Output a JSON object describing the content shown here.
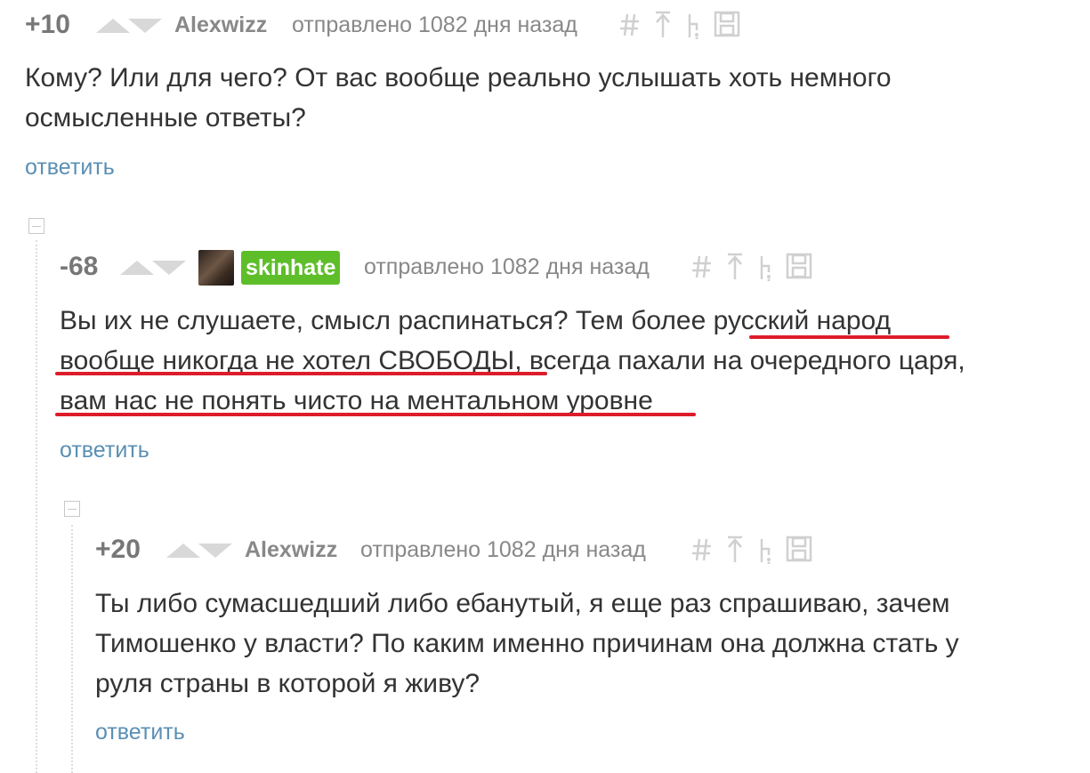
{
  "comments": [
    {
      "score": "+10",
      "author": "Alexwizz",
      "meta": "отправлено 1082 дня назад",
      "body_lines": [
        "Кому? Или для чего? От вас вообще реально услышать хоть немного",
        "осмысленные ответы?"
      ],
      "reply": "ответить"
    },
    {
      "score": "-68",
      "author": "skinhate",
      "meta": "отправлено 1082 дня назад",
      "body_lines": [
        "Вы их не слушаете, смысл распинаться? Тем более русский народ",
        "вообще никогда не хотел СВОБОДЫ, всегда пахали на очередного царя,",
        "вам нас не понять чисто на ментальном уровне"
      ],
      "reply": "ответить"
    },
    {
      "score": "+20",
      "author": "Alexwizz",
      "meta": "отправлено 1082 дня назад",
      "body_lines": [
        "Ты либо сумасшедший либо ебанутый, я еще раз спрашиваю, зачем",
        "Тимошенко у власти? По каким именно причинам она должна стать у",
        "руля страны в которой я живу?"
      ],
      "reply": "ответить"
    }
  ],
  "icons": [
    "hash-icon",
    "parent-arrow-icon",
    "tree-icon",
    "save-icon"
  ],
  "colors": {
    "accent_green": "#5ebe2a",
    "link": "#5a8fb4",
    "underline_red": "#dd1c2a",
    "meta_gray": "#888888"
  }
}
